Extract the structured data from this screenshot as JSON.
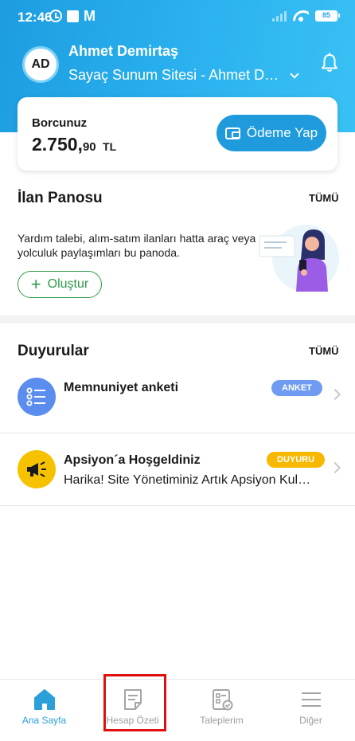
{
  "status_bar": {
    "time": "12:46",
    "carrier_glyph": "M",
    "battery": "85"
  },
  "header": {
    "avatar_initials": "AD",
    "user_name": "Ahmet Demirtaş",
    "site_name": "Sayaç Sunum Sitesi - Ahmet Demirtaş"
  },
  "debt": {
    "label": "Borcunuz",
    "amount_int": "2.750,",
    "amount_dec": "90",
    "currency": "TL",
    "pay_button": "Ödeme Yap"
  },
  "board": {
    "title": "İlan Panosu",
    "see_all": "TÜMÜ",
    "description": "Yardım talebi, alım-satım ilanları hatta araç veya yolculuk paylaşımları bu panoda.",
    "create_button": "Oluştur"
  },
  "announcements": {
    "title": "Duyurular",
    "see_all": "TÜMÜ",
    "items": [
      {
        "title": "Memnuniyet anketi",
        "badge": "ANKET",
        "badge_color": "#6f9cf2",
        "icon": "list-icon",
        "icon_bg": "#5b8def"
      },
      {
        "title": "Apsiyon´a Hoşgeldiniz",
        "subtitle": "Harika! Site Yönetiminiz Artık Apsiyon Kullanıyor",
        "badge": "DUYURU",
        "badge_color": "#f6b800",
        "icon": "megaphone-icon",
        "icon_bg": "#f6c200"
      }
    ]
  },
  "bottom_nav": {
    "items": [
      {
        "label": "Ana Sayfa",
        "icon": "home-icon",
        "active": true
      },
      {
        "label": "Hesap Özeti",
        "icon": "document-icon",
        "active": false
      },
      {
        "label": "Taleplerim",
        "icon": "checklist-icon",
        "active": false
      },
      {
        "label": "Diğer",
        "icon": "menu-icon",
        "active": false
      }
    ]
  },
  "colors": {
    "primary": "#1f9bdd",
    "active_nav": "#2a9fd8",
    "create_green": "#2e9b4a",
    "highlight": "#e01010"
  }
}
